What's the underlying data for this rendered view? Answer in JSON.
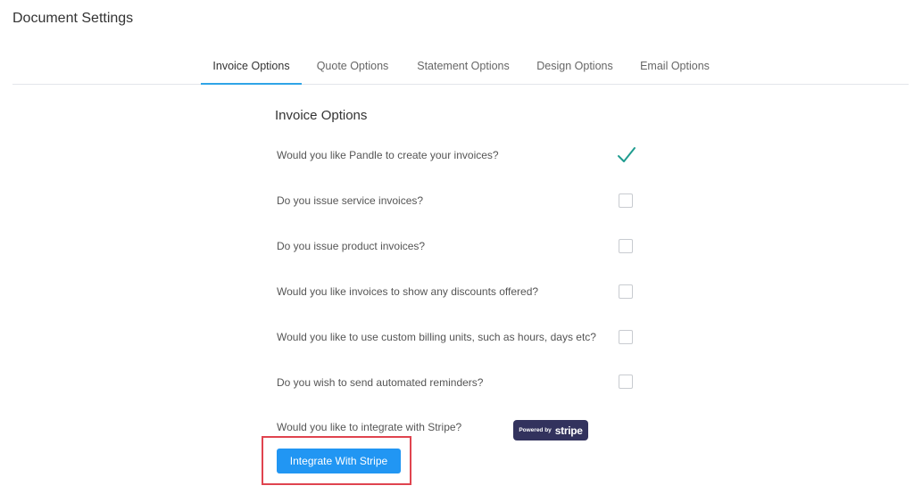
{
  "header": {
    "title": "Document Settings"
  },
  "tabs": [
    {
      "label": "Invoice Options",
      "active": true
    },
    {
      "label": "Quote Options",
      "active": false
    },
    {
      "label": "Statement Options",
      "active": false
    },
    {
      "label": "Design Options",
      "active": false
    },
    {
      "label": "Email Options",
      "active": false
    }
  ],
  "section": {
    "title": "Invoice Options"
  },
  "options": [
    {
      "question": "Would you like Pandle to create your invoices?",
      "checked": true
    },
    {
      "question": "Do you issue service invoices?",
      "checked": false
    },
    {
      "question": "Do you issue product invoices?",
      "checked": false
    },
    {
      "question": "Would you like invoices to show any discounts offered?",
      "checked": false
    },
    {
      "question": "Would you like to use custom billing units, such as hours, days etc?",
      "checked": false
    },
    {
      "question": "Do you wish to send automated reminders?",
      "checked": false
    }
  ],
  "stripe": {
    "question": "Would you like to integrate with Stripe?",
    "badge_powered": "Powered by",
    "badge_brand": "stripe",
    "button_label": "Integrate With Stripe"
  },
  "colors": {
    "accent": "#2196f3",
    "tab_underline": "#2fa4e7",
    "check": "#1f9c8f",
    "highlight": "#e0444f",
    "stripe_badge": "#32325d"
  }
}
